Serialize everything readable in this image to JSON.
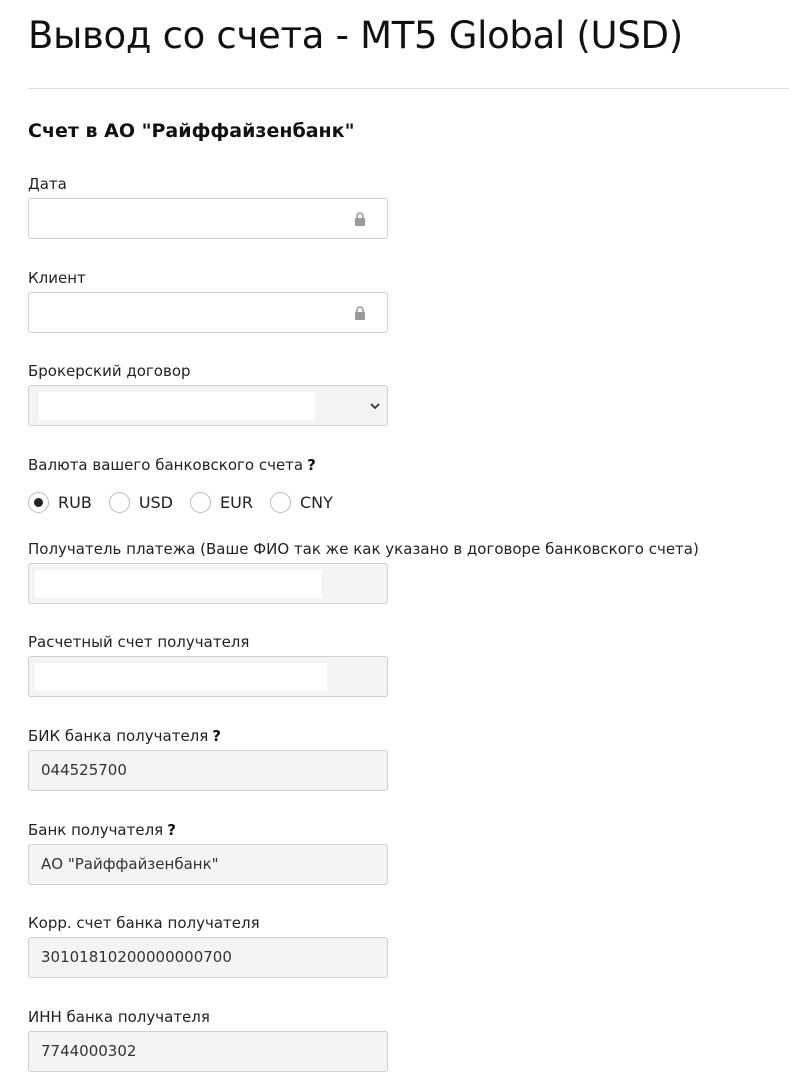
{
  "header": {
    "title": "Вывод со счета  - MT5 Global (USD)"
  },
  "section": {
    "title": "Счет в АО \"Райффайзенбанк\""
  },
  "fields": {
    "date": {
      "label": "Дата",
      "value": "",
      "locked": true
    },
    "client": {
      "label": "Клиент",
      "value": "",
      "locked": true
    },
    "broker_contract": {
      "label": "Брокерский договор",
      "value": ""
    },
    "currency": {
      "label": "Валюта вашего банковского счета",
      "help": "?",
      "selected": "RUB",
      "options": [
        "RUB",
        "USD",
        "EUR",
        "CNY"
      ]
    },
    "recipient": {
      "label": "Получатель платежа (Ваше ФИО так же как указано в договоре банковского счета)",
      "value": ""
    },
    "account": {
      "label": "Расчетный счет получателя",
      "value": ""
    },
    "bik": {
      "label": "БИК банка получателя",
      "help": "?",
      "value": "044525700"
    },
    "bank": {
      "label": "Банк получателя",
      "help": "?",
      "value": "АО \"Райффайзенбанк\""
    },
    "corr_account": {
      "label": "Корр. счет банка получателя",
      "value": "30101810200000000700"
    },
    "inn": {
      "label": "ИНН банка получателя",
      "value": "7744000302"
    }
  },
  "icons": {
    "lock": "lock-icon",
    "select": "chevron-down-icon"
  },
  "colors": {
    "input_border": "#cfcfcf",
    "readonly_bg": "#f4f4f4",
    "text": "#222222"
  }
}
